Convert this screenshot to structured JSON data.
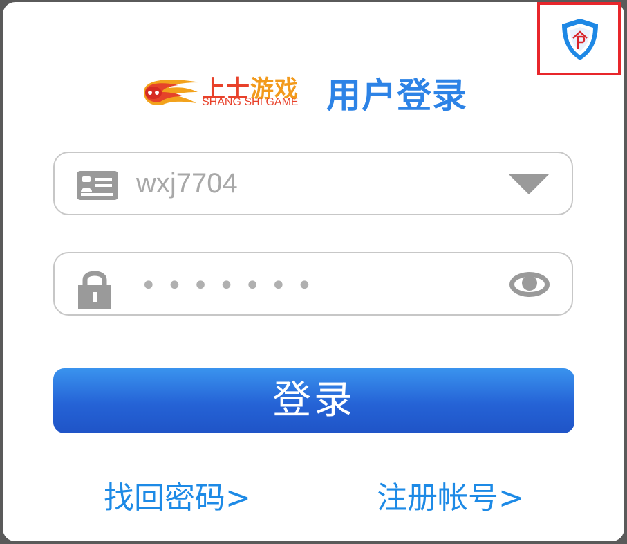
{
  "header": {
    "brand_cn_1": "上士",
    "brand_cn_2": "游戏",
    "brand_en": "SHANG SHI GAME",
    "title": "用户登录"
  },
  "form": {
    "username_value": "wxj7704",
    "password_mask": "•••••••"
  },
  "actions": {
    "login_label": "登录",
    "forgot_label": "找回密码>",
    "register_label": "注册帐号>"
  },
  "icons": {
    "shield": "shield-icon",
    "id_card": "id-card-icon",
    "dropdown": "dropdown-triangle-icon",
    "lock": "lock-icon",
    "eye": "eye-icon",
    "logo": "flame-logo-icon"
  },
  "colors": {
    "accent_blue": "#2d83e6",
    "button_blue": "#2563d6",
    "link_blue": "#1d8ae6",
    "highlight_red": "#e8262b"
  }
}
